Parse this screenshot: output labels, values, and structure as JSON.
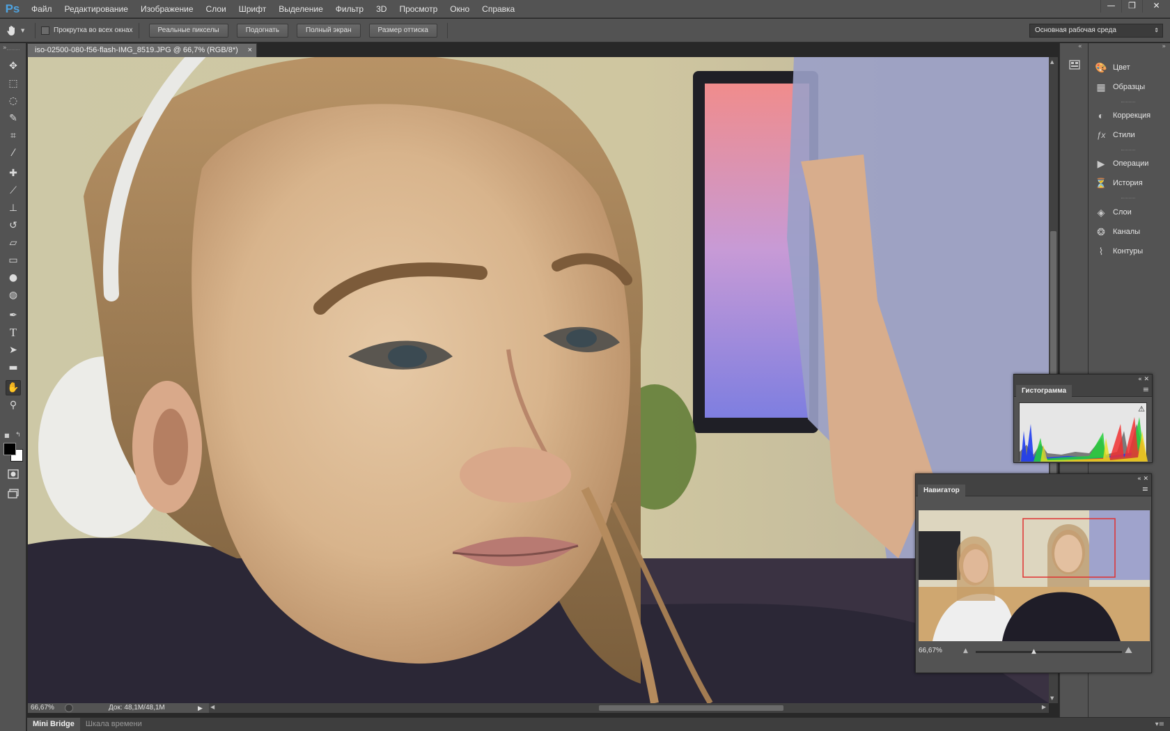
{
  "app": {
    "logo": "Ps"
  },
  "menu": [
    "Файл",
    "Редактирование",
    "Изображение",
    "Слои",
    "Шрифт",
    "Выделение",
    "Фильтр",
    "3D",
    "Просмотр",
    "Окно",
    "Справка"
  ],
  "window_controls": {
    "minimize": "—",
    "restore": "❐",
    "close": "✕"
  },
  "options": {
    "scroll_all_label": "Прокрутка во всех окнах",
    "scroll_all_checked": false,
    "buttons": [
      "Реальные пикселы",
      "Подогнать",
      "Полный экран",
      "Размер оттиска"
    ],
    "workspace": "Основная рабочая среда"
  },
  "tools": [
    "move-icon",
    "marquee-icon",
    "lasso-icon",
    "quick-select-icon",
    "crop-icon",
    "eyedropper-icon",
    "healing-icon",
    "brush-icon",
    "stamp-icon",
    "history-brush-icon",
    "eraser-icon",
    "gradient-icon",
    "blur-icon",
    "dodge-icon",
    "pen-icon",
    "type-icon",
    "path-select-icon",
    "rectangle-icon",
    "hand-icon",
    "zoom-icon"
  ],
  "active_tool": "hand-icon",
  "document": {
    "tab_title": "iso-02500-080-f56-flash-IMG_8519.JPG @ 66,7% (RGB/8*)",
    "close": "×",
    "zoom": "66,67%",
    "doc_info": "Док: 48,1M/48,1M"
  },
  "bottom_tabs": [
    "Mini Bridge",
    "Шкала времени"
  ],
  "dock": [
    {
      "label": "Цвет",
      "icon": "color-palette-icon"
    },
    {
      "label": "Образцы",
      "icon": "swatches-grid-icon"
    },
    {
      "label": "Коррекция",
      "icon": "adjustments-icon"
    },
    {
      "label": "Стили",
      "icon": "styles-fx-icon"
    },
    {
      "label": "Операции",
      "icon": "actions-play-icon"
    },
    {
      "label": "История",
      "icon": "history-icon"
    },
    {
      "label": "Слои",
      "icon": "layers-icon"
    },
    {
      "label": "Каналы",
      "icon": "channels-icon"
    },
    {
      "label": "Контуры",
      "icon": "paths-icon"
    }
  ],
  "histogram": {
    "title": "Гистограмма"
  },
  "navigator": {
    "title": "Навигатор",
    "zoom": "66,67%",
    "zoom_slider_value": 0.4
  },
  "colors": {
    "ui_dark": "#535353",
    "ps_blue": "#4fa3e0",
    "nav_view_box": "#e03030"
  }
}
